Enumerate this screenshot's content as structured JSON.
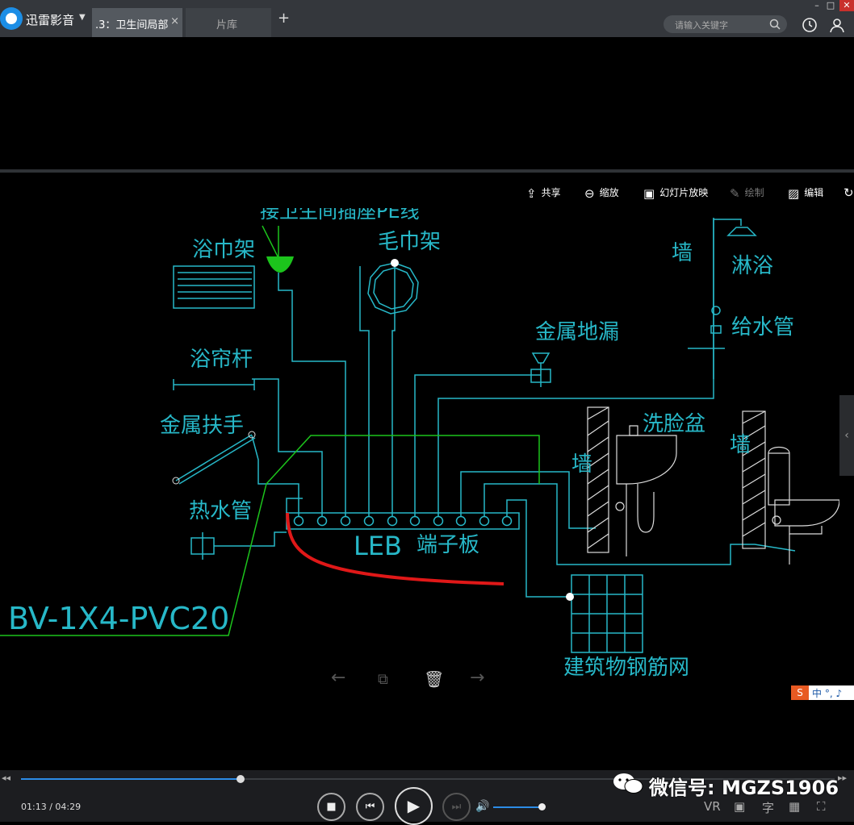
{
  "app": {
    "name": "迅雷影音"
  },
  "tabs": [
    {
      "label": ".3：卫生间局部",
      "close": "×"
    },
    {
      "label": "片库"
    }
  ],
  "new_tab": "+",
  "search": {
    "placeholder": "请输入关键字"
  },
  "viewer_toolbar": [
    {
      "label": "共享",
      "icon": "share-icon",
      "enabled": true
    },
    {
      "label": "缩放",
      "icon": "zoom-icon",
      "enabled": true
    },
    {
      "label": "幻灯片放映",
      "icon": "slideshow-icon",
      "enabled": true
    },
    {
      "label": "绘制",
      "icon": "pen-icon",
      "enabled": false
    },
    {
      "label": "编辑",
      "icon": "edit-image-icon",
      "enabled": true
    }
  ],
  "drawing_labels": {
    "top_partial": "接卫生间插座PE线",
    "towel_rack": "浴巾架",
    "towel_ring": "毛巾架",
    "wall1": "墙",
    "shower": "淋浴",
    "water_pipe": "给水管",
    "floor_drain": "金属地漏",
    "curtain_rod": "浴帘杆",
    "handrail": "金属扶手",
    "basin": "洗脸盆",
    "wall2": "墙",
    "wall3": "墙",
    "hot_pipe": "热水管",
    "leb_a": "LEB",
    "leb_b": "端子板",
    "cable": "BV-1X4-PVC20",
    "rebar": "建筑物钢筋网"
  },
  "watermark": {
    "ime": "S",
    "ime_text": "中 °, ♪"
  },
  "wechat": {
    "text": "微信号: MGZS1906"
  },
  "player": {
    "current": "01:13",
    "duration": "04:29",
    "progress_fraction": 0.27,
    "volume_fraction": 1.0
  },
  "right_controls": {
    "vr": "VR",
    "subtitle": "字"
  },
  "colors": {
    "cad_cyan": "#27b8c8",
    "cad_green": "#1cc41c",
    "cad_red": "#e01818",
    "accent": "#2c8ce6"
  }
}
